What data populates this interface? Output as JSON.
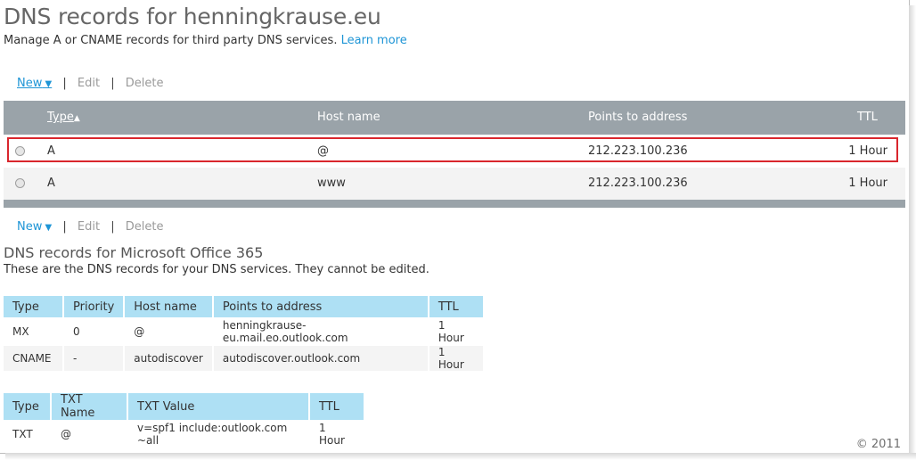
{
  "page": {
    "title": "DNS records for henningkrause.eu",
    "subtitle": "Manage A or CNAME records for third party DNS services.",
    "learn_more": "Learn more"
  },
  "toolbar": {
    "new": "New",
    "edit": "Edit",
    "delete": "Delete",
    "separator": "|"
  },
  "dns_grid": {
    "columns": [
      "Type",
      "Host name",
      "Points to address",
      "TTL"
    ],
    "sort_arrow": "▲",
    "rows": [
      {
        "type": "A",
        "host": "@",
        "address": "212.223.100.236",
        "ttl": "1 Hour",
        "selected": true
      },
      {
        "type": "A",
        "host": "www",
        "address": "212.223.100.236",
        "ttl": "1 Hour",
        "selected": false
      }
    ]
  },
  "office365": {
    "title": "DNS records for Microsoft Office 365",
    "subtitle": "These are the DNS records for your DNS services. They cannot be edited.",
    "table1": {
      "columns": [
        "Type",
        "Priority",
        "Host name",
        "Points to address",
        "TTL"
      ],
      "rows": [
        [
          "MX",
          "0",
          "@",
          "henningkrause-eu.mail.eo.outlook.com",
          "1 Hour"
        ],
        [
          "CNAME",
          "-",
          "autodiscover",
          "autodiscover.outlook.com",
          "1 Hour"
        ]
      ]
    },
    "table2": {
      "columns": [
        "Type",
        "TXT Name",
        "TXT Value",
        "TTL"
      ],
      "rows": [
        [
          "TXT",
          "@",
          "v=spf1 include:outlook.com ~all",
          "1 Hour"
        ]
      ]
    }
  },
  "footer": {
    "copyright": "© 2011"
  },
  "colors": {
    "accent": "#1e95d6",
    "grid_header": "#9aa3a9",
    "table_header": "#aee0f4",
    "selection": "#d9262d"
  }
}
